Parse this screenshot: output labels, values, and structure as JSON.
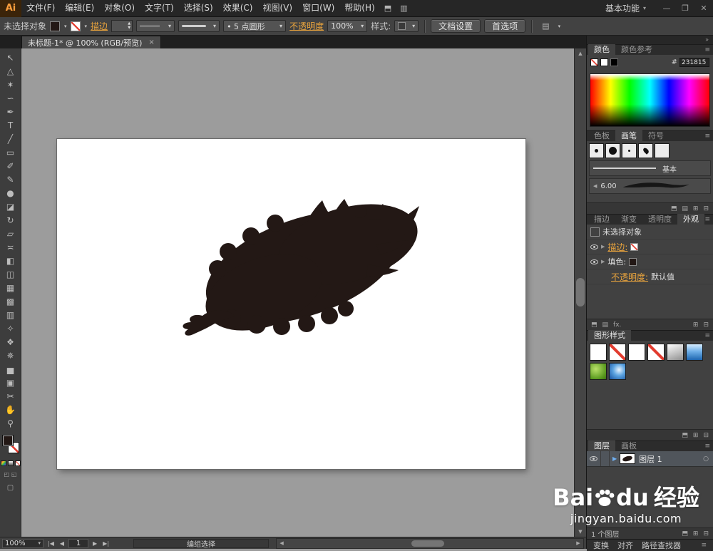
{
  "colors": {
    "splash": "#231815",
    "accent": "#e8a33d",
    "fill_swatch": "#231815"
  },
  "glyphs": {
    "menu": "≡",
    "down": "▾",
    "up_s": "▲",
    "down_s": "▼",
    "left": "◀",
    "right": "▶",
    "up": "▲",
    "dn": "▼",
    "first": "|◀",
    "last": "▶|",
    "tri": "▶",
    "target": "○",
    "new": "⊞",
    "del": "⊟",
    "list": "▤",
    "lib": "⬒",
    "collapse": "»",
    "doc1": "⬒",
    "doc2": "▥",
    "mode1": "◰",
    "mode2": "◱",
    "screen": "▢"
  },
  "menubar": {
    "logo": "Ai",
    "menus": [
      "文件(F)",
      "编辑(E)",
      "对象(O)",
      "文字(T)",
      "选择(S)",
      "效果(C)",
      "视图(V)",
      "窗口(W)",
      "帮助(H)"
    ],
    "workspace": "基本功能",
    "min": "—",
    "restore": "❐",
    "close": "✕"
  },
  "controlbar": {
    "no_selection": "未选择对象",
    "stroke_link": "描边",
    "brush_def": "• 5 点圆形",
    "opacity_link": "不透明度",
    "opacity_colon": ":",
    "opacity_value": "100%",
    "style_label": "样式:",
    "doc_setup": "文档设置",
    "preferences": "首选项"
  },
  "doc_tab": {
    "title": "未标题-1* @ 100% (RGB/预览)",
    "close": "×"
  },
  "tools": [
    {
      "name": "selection",
      "glyph": "↖"
    },
    {
      "name": "direct-selection",
      "glyph": "△"
    },
    {
      "name": "magic-wand",
      "glyph": "✶"
    },
    {
      "name": "lasso",
      "glyph": "∽"
    },
    {
      "name": "pen",
      "glyph": "✒"
    },
    {
      "name": "type",
      "glyph": "T"
    },
    {
      "name": "line-segment",
      "glyph": "╱"
    },
    {
      "name": "rectangle",
      "glyph": "▭"
    },
    {
      "name": "paintbrush",
      "glyph": "✐"
    },
    {
      "name": "pencil",
      "glyph": "✎"
    },
    {
      "name": "blob-brush",
      "glyph": "●"
    },
    {
      "name": "eraser",
      "glyph": "◪"
    },
    {
      "name": "rotate",
      "glyph": "↻"
    },
    {
      "name": "scale",
      "glyph": "▱"
    },
    {
      "name": "width",
      "glyph": "≍"
    },
    {
      "name": "free-transform",
      "glyph": "◧"
    },
    {
      "name": "shape-builder",
      "glyph": "◫"
    },
    {
      "name": "perspective-grid",
      "glyph": "▦"
    },
    {
      "name": "mesh",
      "glyph": "▩"
    },
    {
      "name": "gradient",
      "glyph": "▥"
    },
    {
      "name": "eyedropper",
      "glyph": "✧"
    },
    {
      "name": "blend",
      "glyph": "❖"
    },
    {
      "name": "symbol-sprayer",
      "glyph": "✵"
    },
    {
      "name": "column-graph",
      "glyph": "▅"
    },
    {
      "name": "artboard",
      "glyph": "▣"
    },
    {
      "name": "slice",
      "glyph": "✂"
    },
    {
      "name": "hand",
      "glyph": "✋"
    },
    {
      "name": "zoom",
      "glyph": "⚲"
    }
  ],
  "color_panel": {
    "tab_color": "颜色",
    "tab_guide": "颜色参考",
    "hex_label": "#",
    "hex_value": "231815"
  },
  "brushes_panel": {
    "tab_swatches": "色板",
    "tab_brushes": "画笔",
    "tab_symbols": "符号",
    "item_basic": "基本",
    "item_size": "6.00"
  },
  "appearance_panel": {
    "tab_stroke": "描边",
    "tab_gradient": "渐变",
    "tab_transparency": "透明度",
    "tab_appearance": "外观",
    "no_selection": "未选择对象",
    "stroke_label": "描边:",
    "fill_label": "填色:",
    "opacity_label": "不透明度:",
    "opacity_value": "默认值",
    "fx_label": "fx."
  },
  "styles_panel": {
    "tab": "图形样式",
    "items": [
      {
        "bg": "#ffffff"
      },
      {
        "bg": "#ffffff",
        "overlay": "red-slash"
      },
      {
        "bg": "#ffffff"
      },
      {
        "bg": "#ffffff",
        "overlay": "red-slash"
      },
      {
        "bg": "linear-gradient(160deg,#ffffff 0%,#bdbdbd 60%,#8f8f8f 100%)"
      },
      {
        "bg": "linear-gradient(180deg,#d6ecff 0%,#6fb0e8 45%,#1e66b0 100%)"
      },
      {
        "bg": "radial-gradient(circle at 35% 35%,#b9e169,#5a9a1f 70%,#3f7410)"
      },
      {
        "bg": "radial-gradient(circle at 60% 40%,#e8f4ff,#5aa2e0 45%,#17519e)"
      }
    ]
  },
  "layers_panel": {
    "tab_layers": "图层",
    "tab_artboards": "画板",
    "layer_name": "图层 1",
    "count_label": "1 个图层"
  },
  "dock_bottom": {
    "transform": "变换",
    "align": "对齐",
    "pathfinder": "路径查找器"
  },
  "statusbar": {
    "zoom": "100%",
    "artboard": "1",
    "tool_status": "编组选择"
  },
  "watermark": {
    "bai": "Bai",
    "du": "du",
    "jingyan": "经验",
    "url": "jingyan.baidu.com"
  }
}
